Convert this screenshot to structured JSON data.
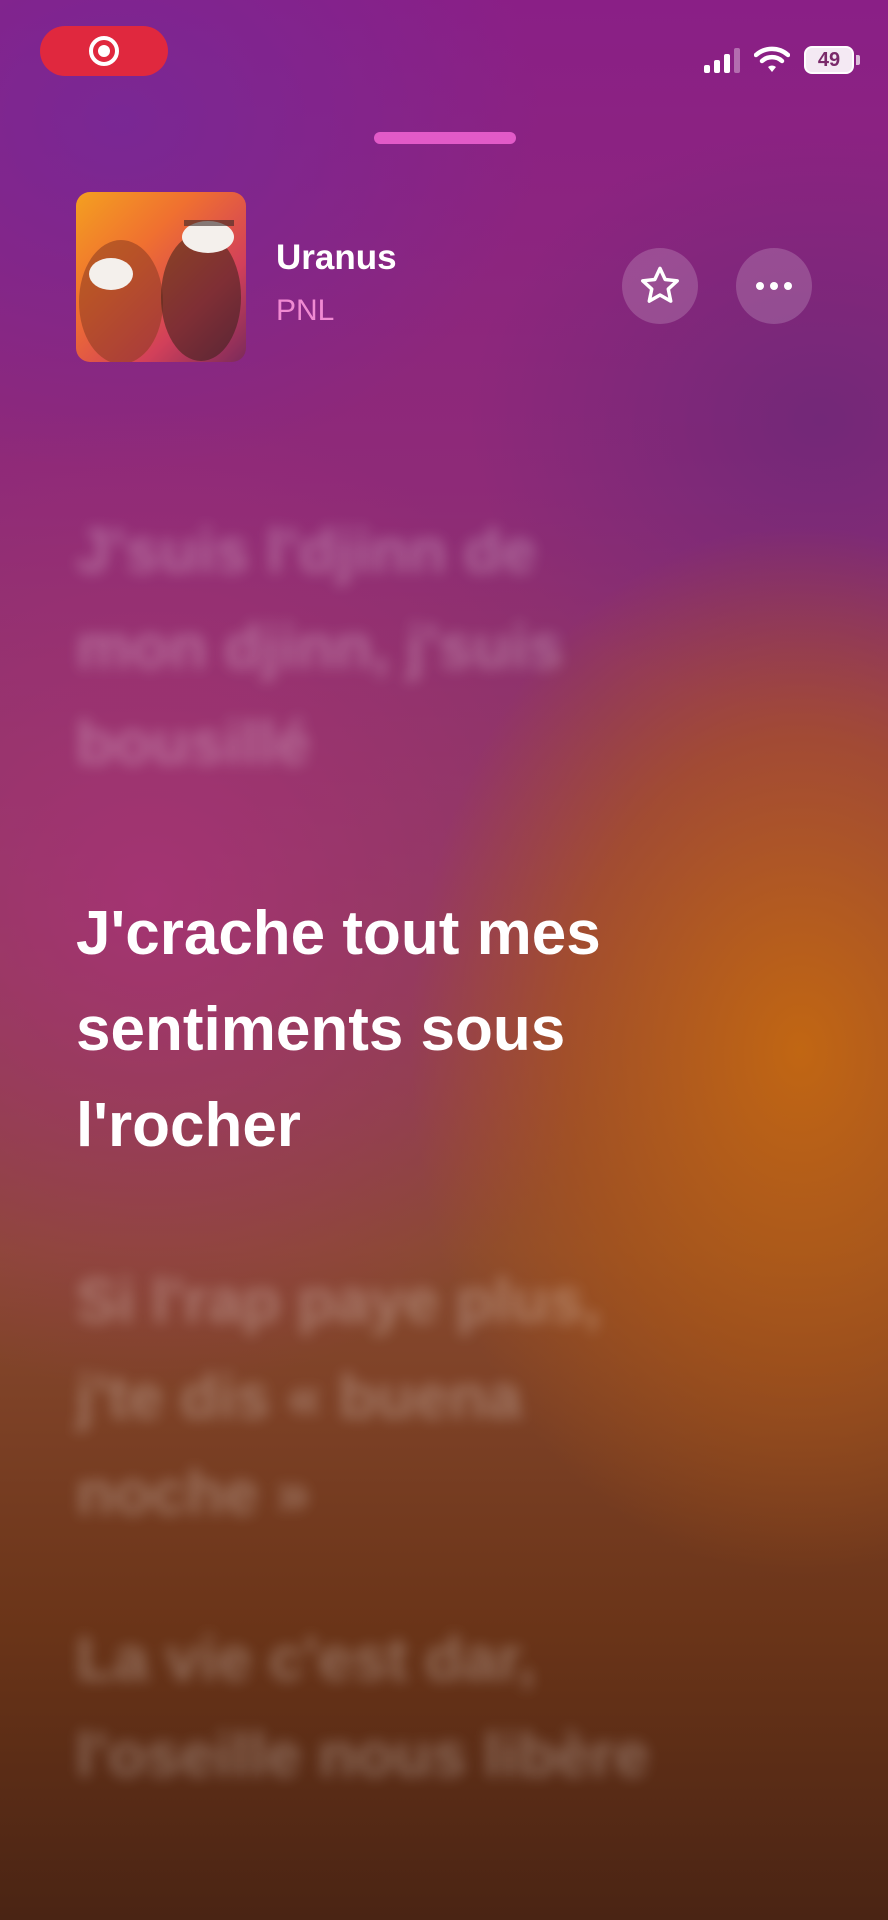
{
  "status_bar": {
    "battery": "49",
    "icons": [
      "screen-recording-icon",
      "cellular-signal-icon",
      "wifi-icon",
      "battery-icon"
    ]
  },
  "now_playing": {
    "title": "Uranus",
    "artist": "PNL",
    "artwork_icon": "album-artwork",
    "favorite_icon": "star-icon",
    "more_icon": "ellipsis-icon"
  },
  "lyrics": [
    {
      "text": "J'suis l'djinn de\nmon djinn, j'suis\nbousillé",
      "state": "past"
    },
    {
      "text": "J'crache tout mes\nsentiments sous\nl'rocher",
      "state": "current"
    },
    {
      "text": "Si l'rap paye plus,\nj'te dis « buena\nnoche »",
      "state": "upcoming"
    },
    {
      "text": "La vie c'est dar,\nl'oseille nous libère",
      "state": "upcoming"
    }
  ],
  "colors": {
    "accent_pink": "#f08ad2",
    "recording_red": "#e0283e",
    "grabber": "#e25ac8"
  }
}
